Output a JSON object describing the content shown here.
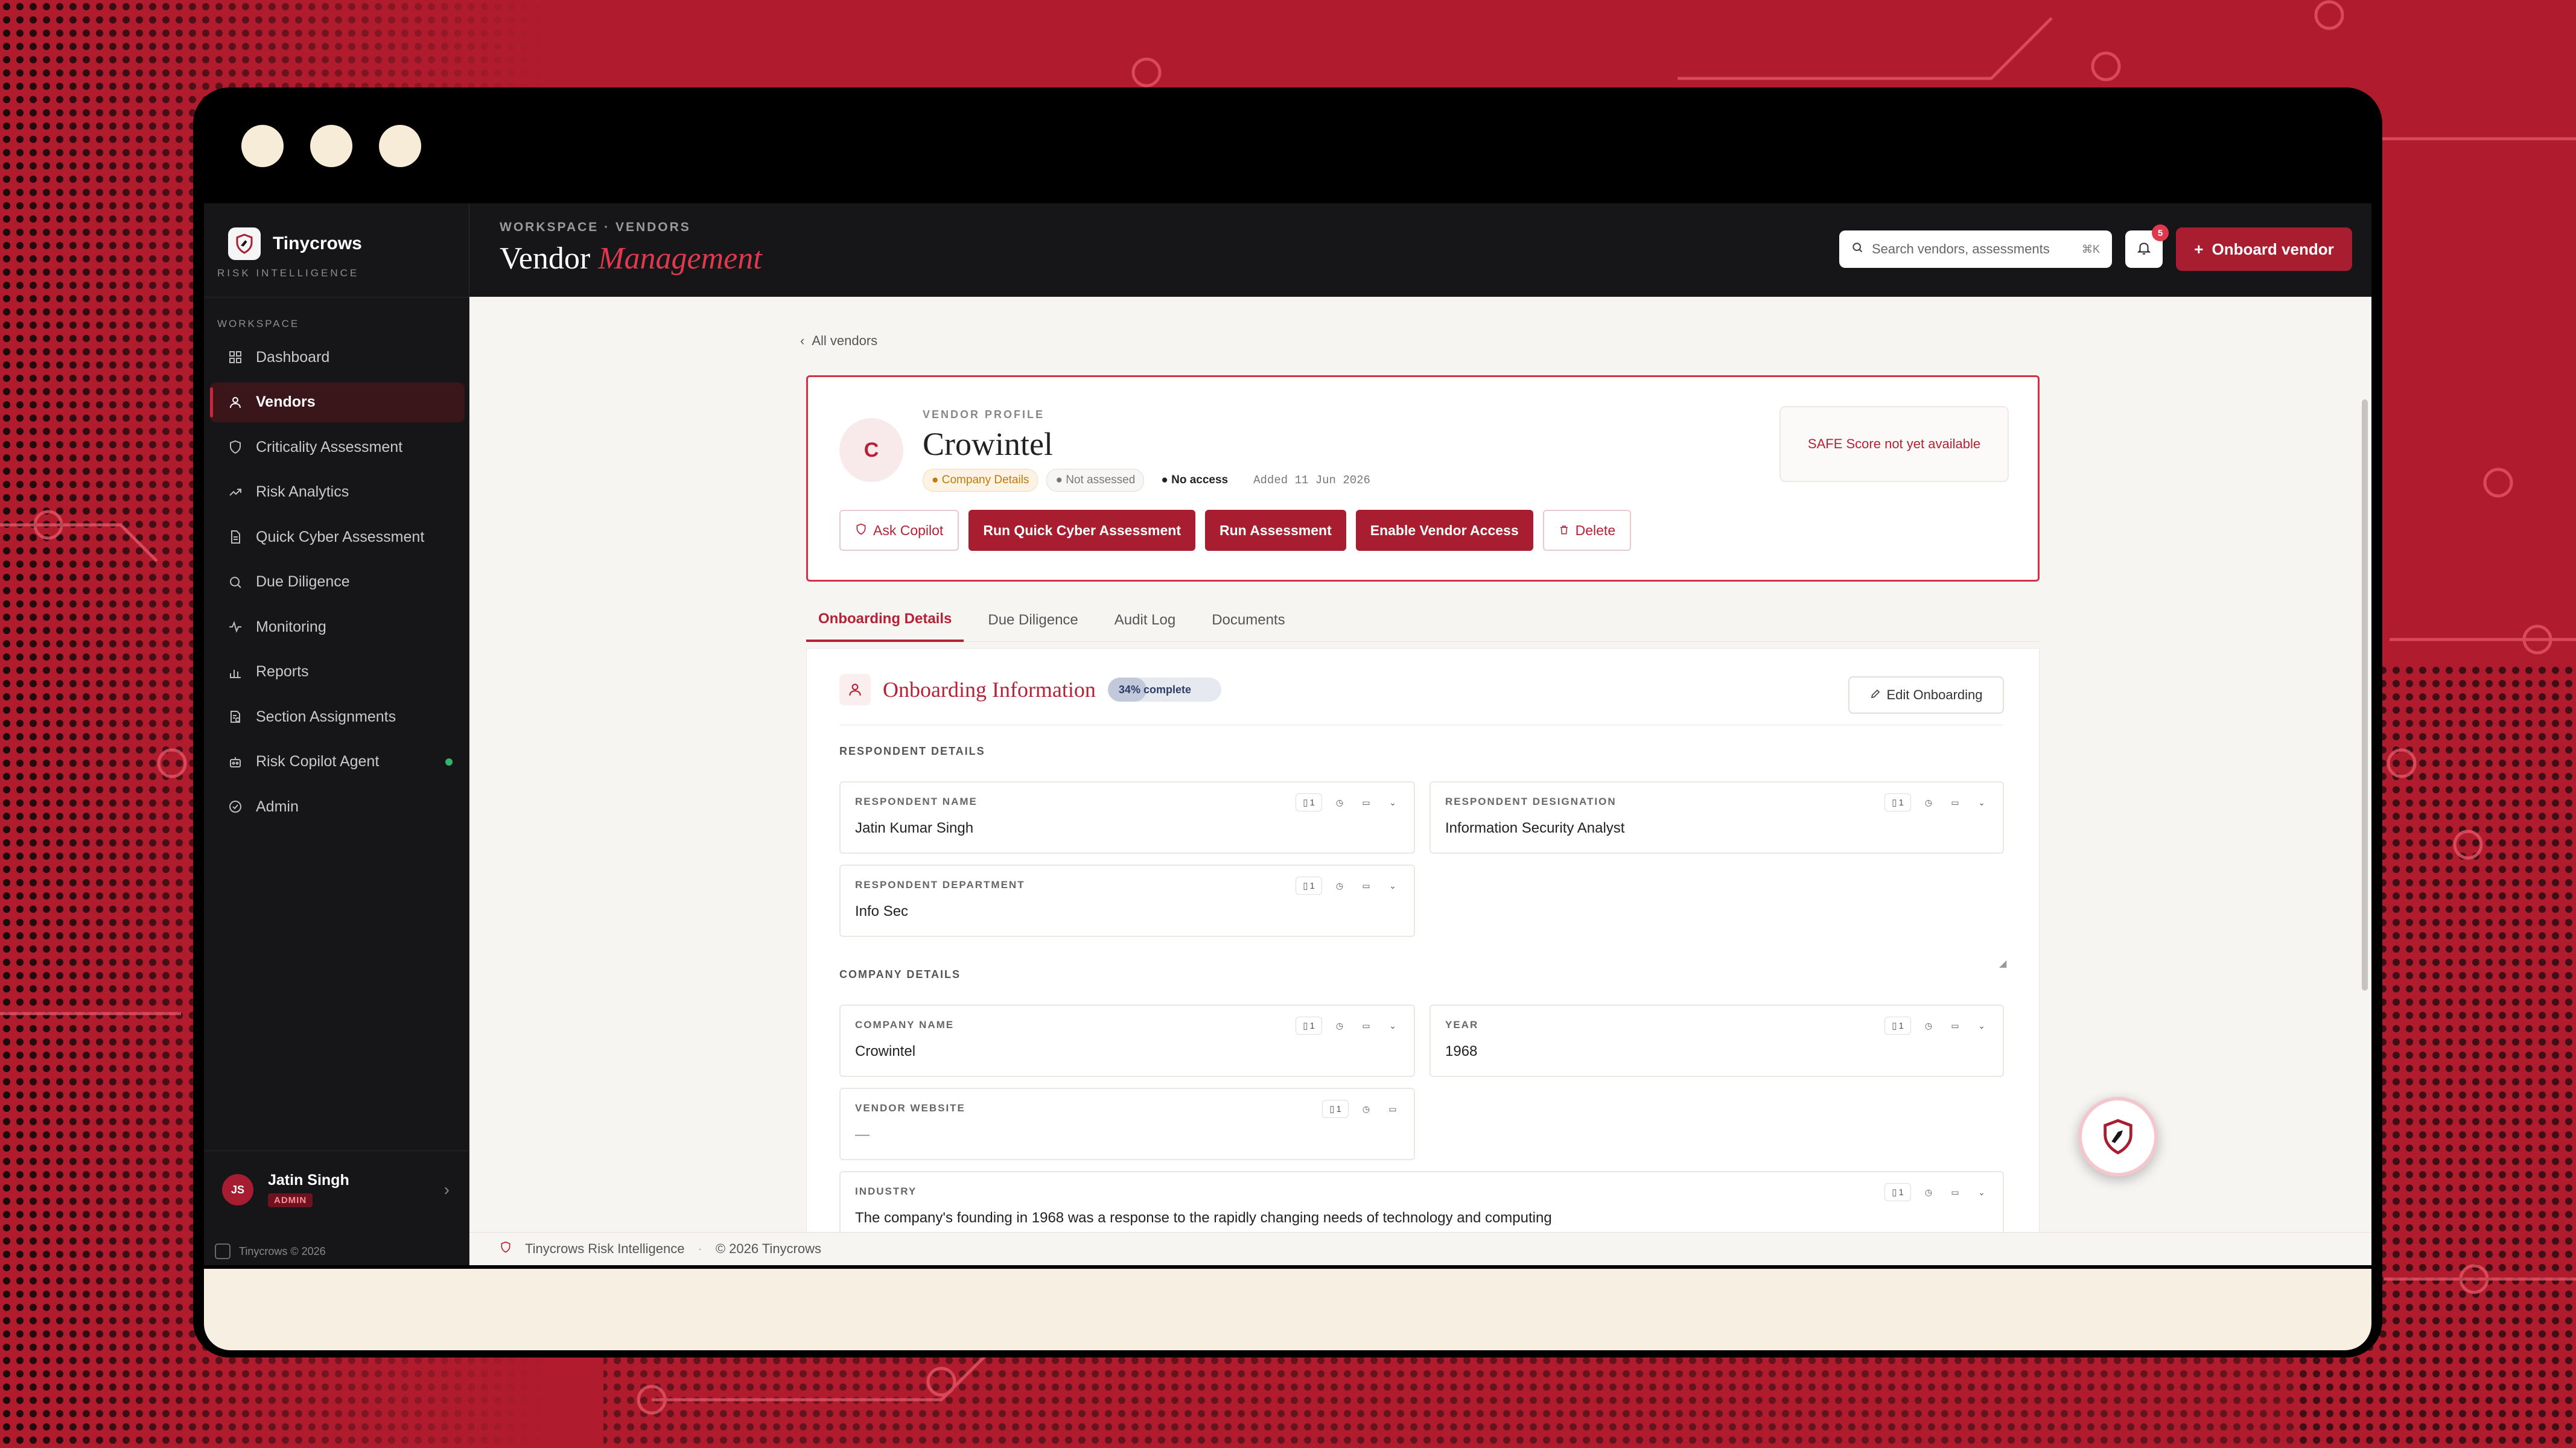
{
  "sidebar": {
    "brand_name": "Tinycrows",
    "brand_sub": "RISK INTELLIGENCE",
    "section_label": "WORKSPACE",
    "items": [
      {
        "label": "Dashboard",
        "icon": "grid-icon",
        "active": false
      },
      {
        "label": "Vendors",
        "icon": "user-icon",
        "active": true
      },
      {
        "label": "Criticality Assessment",
        "icon": "shield-icon",
        "active": false
      },
      {
        "label": "Risk Analytics",
        "icon": "trend-icon",
        "active": false
      },
      {
        "label": "Quick Cyber Assessment",
        "icon": "document-icon",
        "active": false
      },
      {
        "label": "Due Diligence",
        "icon": "search-icon",
        "active": false
      },
      {
        "label": "Monitoring",
        "icon": "pulse-icon",
        "active": false
      },
      {
        "label": "Reports",
        "icon": "bar-chart-icon",
        "active": false
      },
      {
        "label": "Section Assignments",
        "icon": "assignment-icon",
        "active": false
      },
      {
        "label": "Risk Copilot Agent",
        "icon": "bot-icon",
        "active": false,
        "status_dot": "#36b36b"
      },
      {
        "label": "Admin",
        "icon": "check-shield-icon",
        "active": false
      }
    ],
    "user": {
      "initials": "JS",
      "name": "Jatin Singh",
      "role": "ADMIN"
    },
    "copyright": "Tinycrows © 2026"
  },
  "topbar": {
    "breadcrumb": "WORKSPACE · VENDORS",
    "title_plain": "Vendor",
    "title_accent": "Management",
    "search_placeholder": "Search vendors, assessments",
    "search_shortcut": "⌘K",
    "notifications_count": "5",
    "onboard_label": "Onboard vendor"
  },
  "main": {
    "back_link": "All vendors",
    "profile": {
      "label": "VENDOR PROFILE",
      "initial": "C",
      "name": "Crowintel",
      "chips": {
        "company": "Company Details",
        "assessment": "Not assessed",
        "access": "No access",
        "added": "Added 11 Jun 2026"
      },
      "safe_score": "SAFE Score not yet available",
      "actions": {
        "ask_copilot": "Ask Copilot",
        "run_quick": "Run Quick Cyber Assessment",
        "run_assessment": "Run Assessment",
        "enable_access": "Enable Vendor Access",
        "delete": "Delete"
      }
    },
    "tabs": [
      "Onboarding Details",
      "Due Diligence",
      "Audit Log",
      "Documents"
    ],
    "onboarding": {
      "title": "Onboarding Information",
      "progress_label": "34% complete",
      "progress": 0.34,
      "edit_label": "Edit Onboarding",
      "respondent_group": "RESPONDENT DETAILS",
      "company_group": "COMPANY DETAILS",
      "fields": {
        "respondent_name": {
          "label": "RESPONDENT NAME",
          "value": "Jatin Kumar Singh",
          "count": "1"
        },
        "respondent_designation": {
          "label": "RESPONDENT DESIGNATION",
          "value": "Information Security Analyst",
          "count": "1"
        },
        "respondent_department": {
          "label": "RESPONDENT DEPARTMENT",
          "value": "Info Sec",
          "count": "1"
        },
        "company_name": {
          "label": "COMPANY NAME",
          "value": "Crowintel",
          "count": "1"
        },
        "year": {
          "label": "YEAR",
          "value": "1968",
          "count": "1"
        },
        "vendor_website": {
          "label": "VENDOR WEBSITE",
          "value": "—",
          "count": "1"
        },
        "industry": {
          "label": "INDUSTRY",
          "value": "The company's founding in 1968 was a response to the rapidly changing needs of technology and computing",
          "count": "1"
        }
      }
    }
  },
  "footer": {
    "brand": "Tinycrows Risk Intelligence",
    "copyright": "© 2026 Tinycrows"
  },
  "colors": {
    "accent": "#a81d2f",
    "accent_text": "#b52235",
    "sidebar_bg": "#161618",
    "background_red": "#b01c2e"
  }
}
